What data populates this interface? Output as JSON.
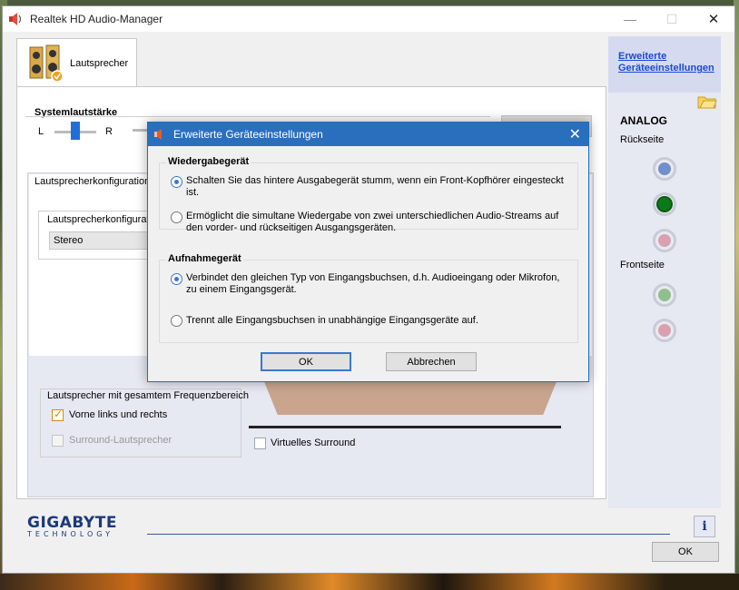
{
  "window": {
    "title": "Realtek HD Audio-Manager",
    "min_glyph": "—",
    "max_glyph": "☐",
    "close_glyph": "✕"
  },
  "tab": {
    "label": "Lautsprecher",
    "icon": "speakers-icon"
  },
  "system_volume": {
    "label": "Systemlautstärke",
    "left": "L",
    "right": "R"
  },
  "speaker_config": {
    "title": "Lautsprecherkonfiguration",
    "sub_label": "Lautsprecherkonfigurat",
    "selected": "Stereo"
  },
  "full_range": {
    "label": "Lautsprecher mit gesamtem Frequenzbereich",
    "front": {
      "label": "Vorne links und rechts",
      "checked": true
    },
    "surround": {
      "label": "Surround-Lautsprecher",
      "checked": false,
      "disabled": true
    }
  },
  "virtual_surround": {
    "label": "Virtuelles Surround",
    "checked": false
  },
  "sidebar": {
    "advanced_link": "Erweiterte Geräteeinstellungen",
    "analog": "ANALOG",
    "back": "Rückseite",
    "front": "Frontseite",
    "back_jacks": [
      "#6f8fcf",
      "#0a7a1a",
      "#d9a0b0"
    ],
    "front_jacks": [
      "#8fbf8f",
      "#d9a0b0"
    ]
  },
  "footer": {
    "logo_main": "GIGABYTE",
    "logo_sub": "TECHNOLOGY",
    "info_glyph": "i",
    "ok": "OK"
  },
  "dialog": {
    "title": "Erweiterte Geräteeinstellungen",
    "close_glyph": "✕",
    "playback": {
      "title": "Wiedergabegerät",
      "options": [
        {
          "text": "Schalten Sie das hintere Ausgabegerät stumm, wenn ein Front-Kopfhörer eingesteckt ist.",
          "checked": true
        },
        {
          "text": "Ermöglicht die simultane Wiedergabe von zwei unterschiedlichen Audio-Streams auf den vorder- und rückseitigen Ausgangsgeräten.",
          "checked": false
        }
      ]
    },
    "recording": {
      "title": "Aufnahmegerät",
      "options": [
        {
          "text": "Verbindet den gleichen Typ von Eingangsbuchsen, d.h. Audioeingang oder Mikrofon, zu einem Eingangsgerät.",
          "checked": true
        },
        {
          "text": "Trennt alle Eingangsbuchsen in unabhängige Eingangsgeräte auf.",
          "checked": false
        }
      ]
    },
    "ok": "OK",
    "cancel": "Abbrechen"
  }
}
